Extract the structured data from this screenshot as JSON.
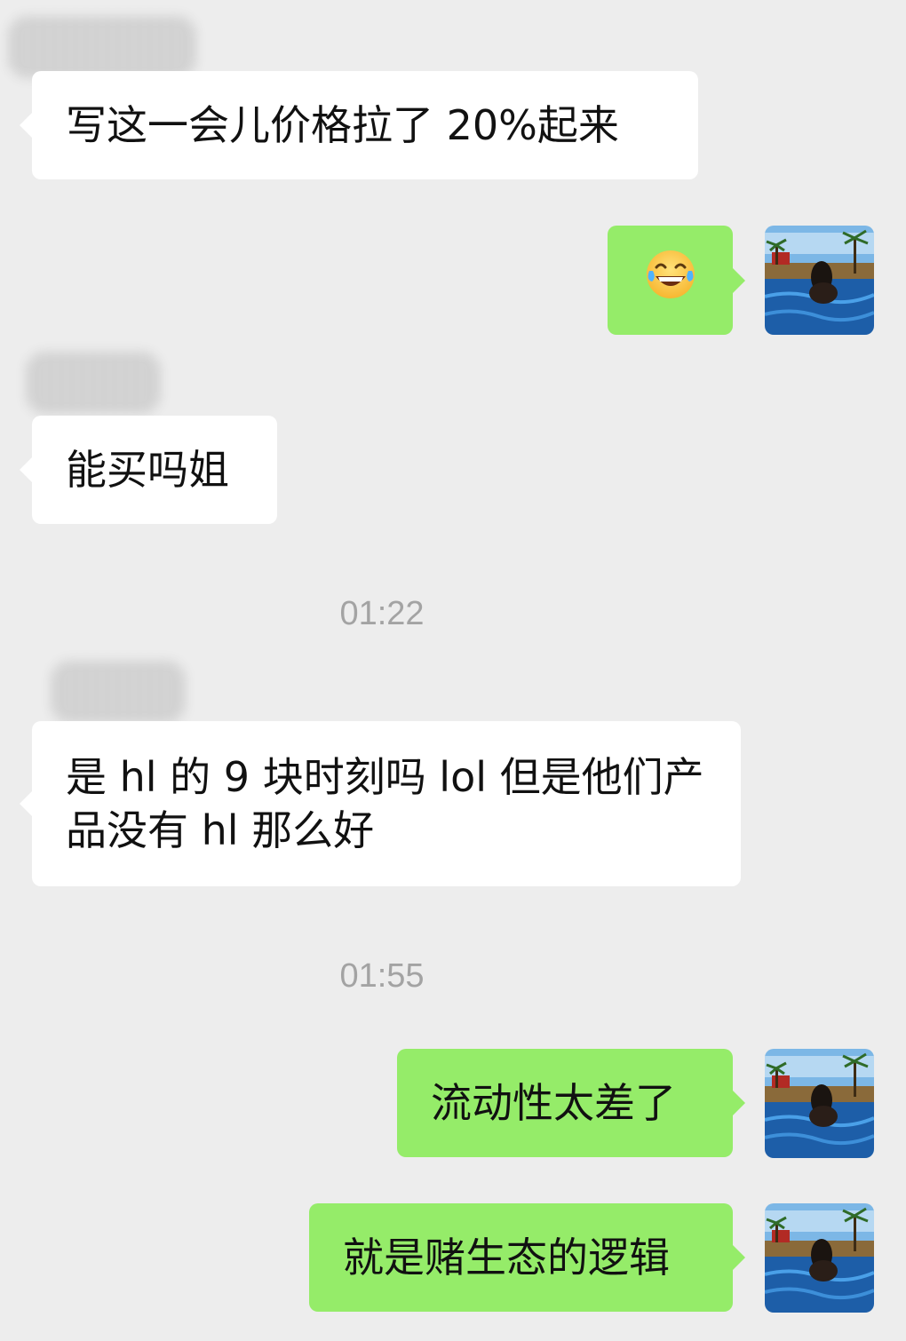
{
  "messages": [
    {
      "direction": "incoming",
      "text": "写这一会儿价格拉了 20%起来"
    },
    {
      "direction": "outgoing",
      "emoji": "tears-of-joy-emoji"
    },
    {
      "direction": "incoming",
      "text": "能买吗姐"
    },
    {
      "type": "timestamp",
      "text": "01:22"
    },
    {
      "direction": "incoming",
      "text": "是 hl 的 9 块时刻吗 lol 但是他们产品没有 hl 那么好"
    },
    {
      "type": "timestamp",
      "text": "01:55"
    },
    {
      "direction": "outgoing",
      "text": "流动性太差了"
    },
    {
      "direction": "outgoing",
      "text": "就是赌生态的逻辑"
    }
  ],
  "colors": {
    "background": "#ededed",
    "incoming_bubble": "#ffffff",
    "outgoing_bubble": "#95ec69",
    "timestamp": "#a3a3a3"
  }
}
